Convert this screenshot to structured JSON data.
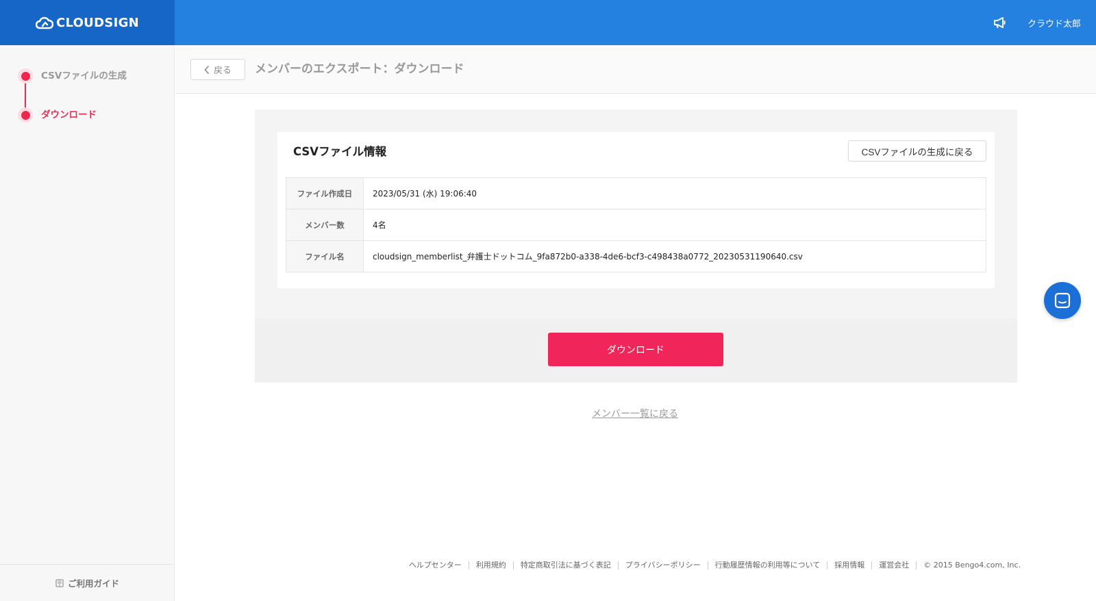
{
  "header": {
    "logo_text": "CLOUDSIGN",
    "user_name": "クラウド太郎",
    "brand_color": "#2481e0",
    "logo_bg_color": "#1566c7",
    "notification_icon": "megaphone-icon"
  },
  "sidebar": {
    "steps": [
      {
        "label": "CSVファイルの生成",
        "active": false
      },
      {
        "label": "ダウンロード",
        "active": true
      }
    ],
    "guide_label": "ご利用ガイド",
    "guide_icon": "book-icon",
    "accent_color": "#f0264f"
  },
  "pagebar": {
    "back_label": "戻る",
    "title": "メンバーのエクスポート：ダウンロード"
  },
  "card": {
    "title": "CSVファイル情報",
    "regenerate_label": "CSVファイルの生成に戻る",
    "rows": [
      {
        "label": "ファイル作成日",
        "value": "2023/05/31 (水) 19:06:40"
      },
      {
        "label": "メンバー数",
        "value": "4名"
      },
      {
        "label": "ファイル名",
        "value": "cloudsign_memberlist_弁護士ドットコム_9fa872b0-a338-4de6-bcf3-c498438a0772_20230531190640.csv"
      }
    ]
  },
  "download_label": "ダウンロード",
  "download_color": "#f0265a",
  "back_to_list_label": "メンバー一覧に戻る",
  "chat_icon": "chat-icon",
  "footer": {
    "links": [
      "ヘルプセンター",
      "利用規約",
      "特定商取引法に基づく表記",
      "プライバシーポリシー",
      "行動履歴情報の利用等について",
      "採用情報",
      "運営会社"
    ],
    "copyright": "© 2015 Bengo4.com, Inc."
  }
}
